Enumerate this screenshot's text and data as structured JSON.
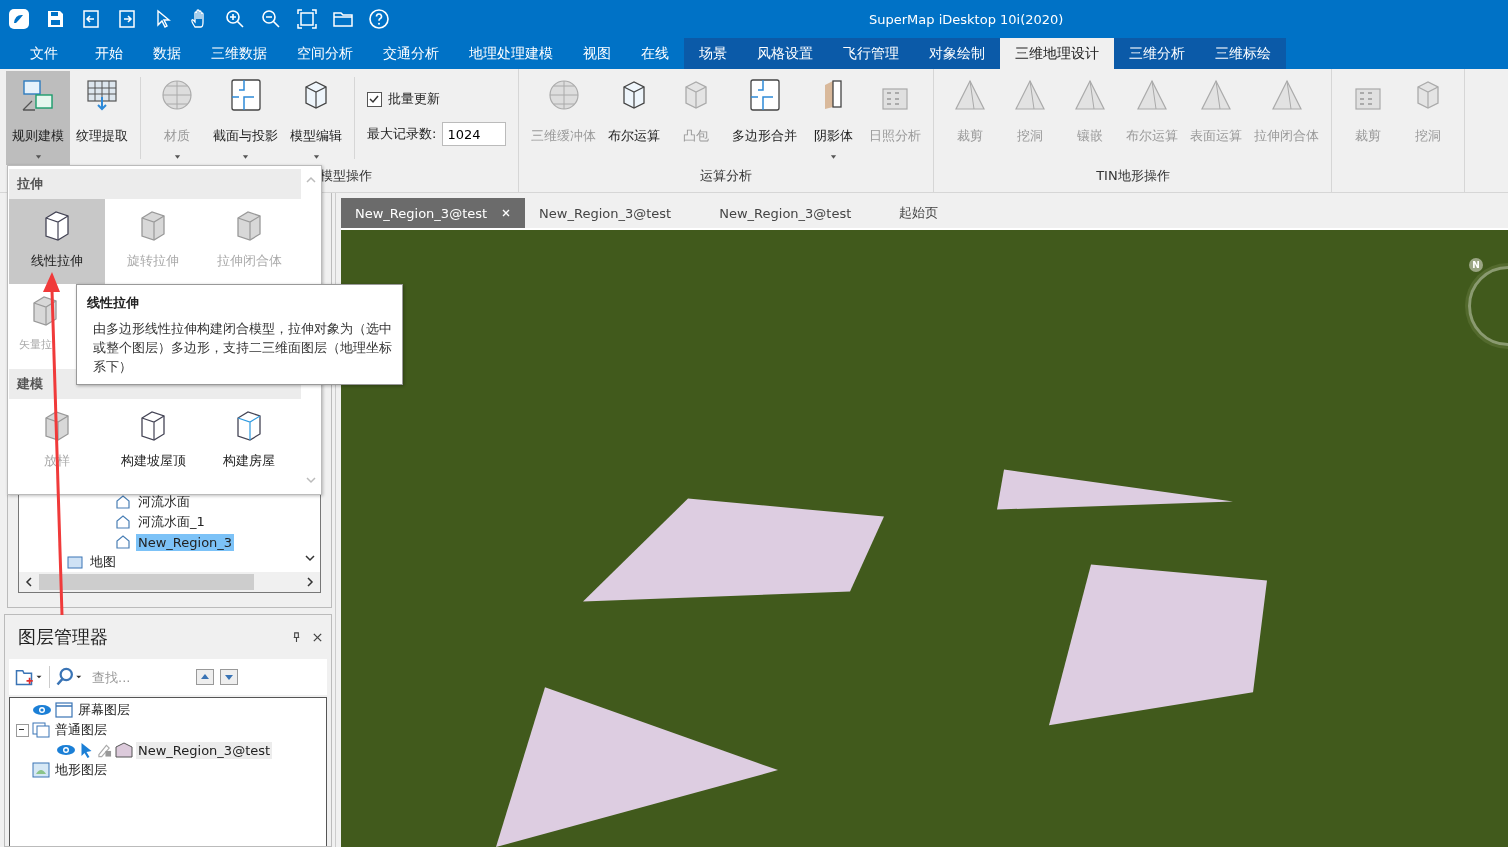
{
  "window": {
    "title": "SuperMap iDesktop 10i(2020)"
  },
  "menu_tabs": [
    {
      "label": "文件",
      "selected": false,
      "contextual": false
    },
    {
      "label": "开始",
      "selected": false,
      "contextual": false
    },
    {
      "label": "数据",
      "selected": false,
      "contextual": false
    },
    {
      "label": "三维数据",
      "selected": false,
      "contextual": false
    },
    {
      "label": "空间分析",
      "selected": false,
      "contextual": false
    },
    {
      "label": "交通分析",
      "selected": false,
      "contextual": false
    },
    {
      "label": "地理处理建模",
      "selected": false,
      "contextual": false
    },
    {
      "label": "视图",
      "selected": false,
      "contextual": false
    },
    {
      "label": "在线",
      "selected": false,
      "contextual": false
    },
    {
      "label": "场景",
      "selected": false,
      "contextual": true
    },
    {
      "label": "风格设置",
      "selected": false,
      "contextual": true
    },
    {
      "label": "飞行管理",
      "selected": false,
      "contextual": true
    },
    {
      "label": "对象绘制",
      "selected": false,
      "contextual": true
    },
    {
      "label": "三维地理设计",
      "selected": true,
      "contextual": true
    },
    {
      "label": "三维分析",
      "selected": false,
      "contextual": true
    },
    {
      "label": "三维标绘",
      "selected": false,
      "contextual": true
    }
  ],
  "ribbon": {
    "groups": [
      {
        "label": "模型操作",
        "buttons": [
          {
            "label": "规则建模",
            "selected": true,
            "disabled": false,
            "dropdown": true
          },
          {
            "label": "纹理提取",
            "selected": false,
            "disabled": false,
            "dropdown": false
          },
          {
            "label": "材质",
            "selected": false,
            "disabled": true,
            "dropdown": true
          },
          {
            "label": "截面与投影",
            "selected": false,
            "disabled": false,
            "dropdown": true
          },
          {
            "label": "模型编辑",
            "selected": false,
            "disabled": false,
            "dropdown": true
          }
        ],
        "batch_update": {
          "label": "批量更新",
          "checked": true
        },
        "max_records": {
          "label": "最大记录数:",
          "value": "1024"
        }
      },
      {
        "label": "运算分析",
        "buttons": [
          {
            "label": "三维缓冲体",
            "selected": false,
            "disabled": true,
            "dropdown": false
          },
          {
            "label": "布尔运算",
            "selected": false,
            "disabled": false,
            "dropdown": false
          },
          {
            "label": "凸包",
            "selected": false,
            "disabled": true,
            "dropdown": false
          },
          {
            "label": "多边形合并",
            "selected": false,
            "disabled": false,
            "dropdown": false
          },
          {
            "label": "阴影体",
            "selected": false,
            "disabled": false,
            "dropdown": true
          },
          {
            "label": "日照分析",
            "selected": false,
            "disabled": true,
            "dropdown": false
          }
        ]
      },
      {
        "label": "TIN地形操作",
        "buttons": [
          {
            "label": "裁剪",
            "selected": false,
            "disabled": true,
            "dropdown": false
          },
          {
            "label": "挖洞",
            "selected": false,
            "disabled": true,
            "dropdown": false
          },
          {
            "label": "镶嵌",
            "selected": false,
            "disabled": true,
            "dropdown": false
          },
          {
            "label": "布尔运算",
            "selected": false,
            "disabled": true,
            "dropdown": false
          },
          {
            "label": "表面运算",
            "selected": false,
            "disabled": true,
            "dropdown": false
          },
          {
            "label": "拉伸闭合体",
            "selected": false,
            "disabled": true,
            "dropdown": false
          }
        ]
      },
      {
        "buttons": [
          {
            "label": "裁剪",
            "selected": false,
            "disabled": true,
            "dropdown": false
          },
          {
            "label": "挖洞",
            "selected": false,
            "disabled": true,
            "dropdown": false
          }
        ]
      }
    ]
  },
  "popup": {
    "sections": [
      {
        "title": "拉伸",
        "items": [
          {
            "label": "线性拉伸",
            "selected": true,
            "disabled": false
          },
          {
            "label": "旋转拉伸",
            "selected": false,
            "disabled": true
          },
          {
            "label": "拉伸闭合体",
            "selected": false,
            "disabled": true
          },
          {
            "label": "矢量拉",
            "selected": false,
            "disabled": true
          }
        ]
      },
      {
        "title": "建模",
        "items": [
          {
            "label": "放样",
            "selected": false,
            "disabled": true
          },
          {
            "label": "构建坡屋顶",
            "selected": false,
            "disabled": false
          },
          {
            "label": "构建房屋",
            "selected": false,
            "disabled": false
          }
        ]
      }
    ]
  },
  "tooltip": {
    "title": "线性拉伸",
    "text": "由多边形线性拉伸构建闭合模型，拉伸对象为（选中或整个图层）多边形，支持二三维面图层（地理坐标系下）"
  },
  "workspace_tree": {
    "items": [
      {
        "label": "河流水面",
        "kind": "dataset",
        "selected": false
      },
      {
        "label": "河流水面_1",
        "kind": "dataset",
        "selected": false
      },
      {
        "label": "New_Region_3",
        "kind": "dataset",
        "selected": true
      },
      {
        "label": "地图",
        "kind": "map",
        "selected": false
      }
    ]
  },
  "layer_manager": {
    "title": "图层管理器",
    "search": {
      "placeholder": "查找..."
    },
    "layers": [
      {
        "label": "屏幕图层",
        "kind": "screen",
        "visible": true
      },
      {
        "label": "普通图层",
        "kind": "normal",
        "expanded": true,
        "children": [
          {
            "label": "New_Region_3@test",
            "kind": "region",
            "visible": true,
            "selectable": true,
            "editable": false
          }
        ]
      },
      {
        "label": "地形图层",
        "kind": "terrain"
      }
    ]
  },
  "doc_tabs": [
    {
      "label": "New_Region_3@test",
      "selected": true,
      "closable": true
    },
    {
      "label": "New_Region_3@test",
      "selected": false,
      "closable": false
    },
    {
      "label": "New_Region_3@test",
      "selected": false,
      "closable": false
    },
    {
      "label": "起始页",
      "selected": false,
      "closable": false
    }
  ],
  "scene": {
    "compass": {
      "label": "N"
    }
  }
}
